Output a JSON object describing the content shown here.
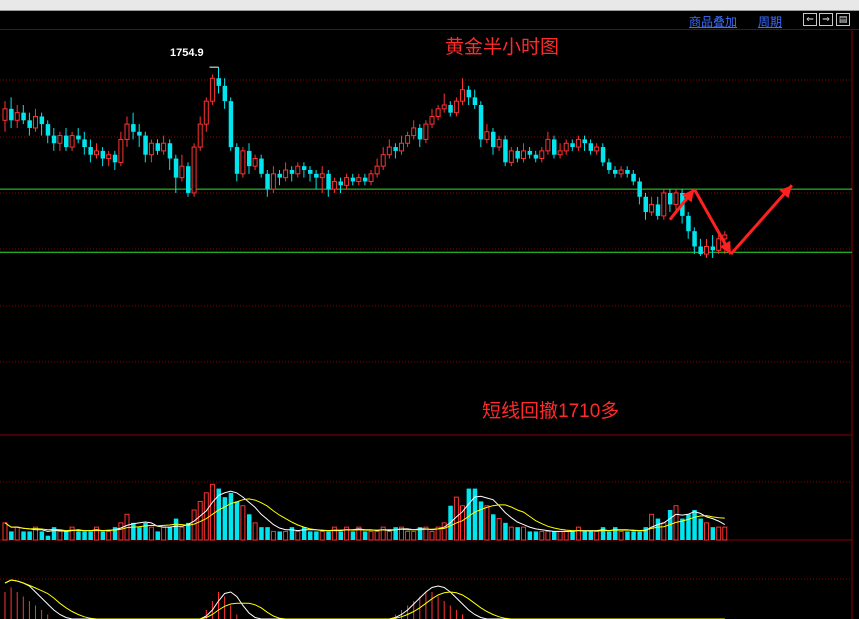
{
  "toolbar": {
    "overlay_label": "商品叠加",
    "period_label": "周期",
    "buttons": [
      {
        "name": "scroll-left-icon",
        "glyph": "⇐"
      },
      {
        "name": "scroll-right-icon",
        "glyph": "⇒"
      },
      {
        "name": "panel-toggle-icon",
        "glyph": "▤"
      }
    ]
  },
  "chart": {
    "title": "黄金半小时图",
    "annotation": "短线回撤1710多",
    "high_label": "1754.9",
    "colors": {
      "background": "#000000",
      "up": "#ff3232",
      "down": "#00e5ee",
      "grid": "#8b0000",
      "support": "#2ee02e",
      "arrow": "#ff2020",
      "ma_white": "#ffffff",
      "ma_yellow": "#ffff00"
    }
  },
  "chart_data": [
    {
      "type": "candlestick",
      "title": "黄金半小时图",
      "note": "price scale labels not visible; values in approximate price units",
      "ylim": [
        1694,
        1762
      ],
      "horizontal_lines": [
        1723,
        1706.5
      ],
      "high_marker": {
        "label": "1754.9",
        "index": 35,
        "value": 1754.9
      },
      "annotation": "短线回撤1710多",
      "candles": [
        {
          "o": 1741,
          "c": 1744,
          "h": 1746,
          "l": 1738
        },
        {
          "o": 1744,
          "c": 1741,
          "h": 1747,
          "l": 1739
        },
        {
          "o": 1741,
          "c": 1743,
          "h": 1745,
          "l": 1739
        },
        {
          "o": 1743,
          "c": 1741,
          "h": 1745,
          "l": 1740
        },
        {
          "o": 1741,
          "c": 1739,
          "h": 1743,
          "l": 1737
        },
        {
          "o": 1739,
          "c": 1742,
          "h": 1744,
          "l": 1738
        },
        {
          "o": 1742,
          "c": 1740,
          "h": 1743,
          "l": 1737
        },
        {
          "o": 1740,
          "c": 1737,
          "h": 1741,
          "l": 1735
        },
        {
          "o": 1737,
          "c": 1735,
          "h": 1739,
          "l": 1733
        },
        {
          "o": 1735,
          "c": 1737,
          "h": 1738,
          "l": 1733
        },
        {
          "o": 1737,
          "c": 1734,
          "h": 1739,
          "l": 1733
        },
        {
          "o": 1734,
          "c": 1737,
          "h": 1738,
          "l": 1733
        },
        {
          "o": 1737,
          "c": 1736,
          "h": 1739,
          "l": 1735
        },
        {
          "o": 1736,
          "c": 1734,
          "h": 1738,
          "l": 1732
        },
        {
          "o": 1734,
          "c": 1732,
          "h": 1736,
          "l": 1730
        },
        {
          "o": 1732,
          "c": 1733,
          "h": 1735,
          "l": 1731
        },
        {
          "o": 1733,
          "c": 1731,
          "h": 1734,
          "l": 1729
        },
        {
          "o": 1731,
          "c": 1732,
          "h": 1733,
          "l": 1729
        },
        {
          "o": 1732,
          "c": 1730,
          "h": 1733,
          "l": 1728
        },
        {
          "o": 1730,
          "c": 1736,
          "h": 1738,
          "l": 1729
        },
        {
          "o": 1736,
          "c": 1740,
          "h": 1742,
          "l": 1734
        },
        {
          "o": 1740,
          "c": 1738,
          "h": 1743,
          "l": 1736
        },
        {
          "o": 1738,
          "c": 1737,
          "h": 1740,
          "l": 1734
        },
        {
          "o": 1737,
          "c": 1732,
          "h": 1738,
          "l": 1730
        },
        {
          "o": 1732,
          "c": 1735,
          "h": 1736,
          "l": 1730
        },
        {
          "o": 1735,
          "c": 1733,
          "h": 1736,
          "l": 1732
        },
        {
          "o": 1733,
          "c": 1735,
          "h": 1737,
          "l": 1732
        },
        {
          "o": 1735,
          "c": 1731,
          "h": 1736,
          "l": 1728
        },
        {
          "o": 1731,
          "c": 1726,
          "h": 1732,
          "l": 1722
        },
        {
          "o": 1726,
          "c": 1729,
          "h": 1732,
          "l": 1725
        },
        {
          "o": 1729,
          "c": 1722,
          "h": 1730,
          "l": 1721
        },
        {
          "o": 1722,
          "c": 1734,
          "h": 1735,
          "l": 1721
        },
        {
          "o": 1734,
          "c": 1740,
          "h": 1742,
          "l": 1733
        },
        {
          "o": 1740,
          "c": 1746,
          "h": 1747,
          "l": 1738
        },
        {
          "o": 1746,
          "c": 1752,
          "h": 1753,
          "l": 1745
        },
        {
          "o": 1752,
          "c": 1750,
          "h": 1754.9,
          "l": 1748
        },
        {
          "o": 1750,
          "c": 1746,
          "h": 1752,
          "l": 1744
        },
        {
          "o": 1746,
          "c": 1734,
          "h": 1747,
          "l": 1733
        },
        {
          "o": 1734,
          "c": 1727,
          "h": 1735,
          "l": 1725
        },
        {
          "o": 1727,
          "c": 1733,
          "h": 1734,
          "l": 1726
        },
        {
          "o": 1733,
          "c": 1729,
          "h": 1735,
          "l": 1727
        },
        {
          "o": 1729,
          "c": 1731,
          "h": 1732,
          "l": 1728
        },
        {
          "o": 1731,
          "c": 1727,
          "h": 1732,
          "l": 1726
        },
        {
          "o": 1727,
          "c": 1723,
          "h": 1728,
          "l": 1721
        },
        {
          "o": 1723,
          "c": 1727,
          "h": 1729,
          "l": 1722
        },
        {
          "o": 1727,
          "c": 1726,
          "h": 1728,
          "l": 1724
        },
        {
          "o": 1726,
          "c": 1728,
          "h": 1730,
          "l": 1725
        },
        {
          "o": 1728,
          "c": 1727,
          "h": 1729,
          "l": 1725
        },
        {
          "o": 1727,
          "c": 1729,
          "h": 1730,
          "l": 1726
        },
        {
          "o": 1729,
          "c": 1728,
          "h": 1730,
          "l": 1726
        },
        {
          "o": 1728,
          "c": 1727,
          "h": 1729,
          "l": 1725
        },
        {
          "o": 1727,
          "c": 1726,
          "h": 1728,
          "l": 1723
        },
        {
          "o": 1726,
          "c": 1727,
          "h": 1729,
          "l": 1722
        },
        {
          "o": 1727,
          "c": 1723,
          "h": 1728,
          "l": 1721
        },
        {
          "o": 1723,
          "c": 1725,
          "h": 1726,
          "l": 1722
        },
        {
          "o": 1725,
          "c": 1724,
          "h": 1726,
          "l": 1722
        },
        {
          "o": 1724,
          "c": 1726,
          "h": 1727,
          "l": 1723
        },
        {
          "o": 1726,
          "c": 1725,
          "h": 1727,
          "l": 1724
        },
        {
          "o": 1725,
          "c": 1726,
          "h": 1727,
          "l": 1724
        },
        {
          "o": 1726,
          "c": 1725,
          "h": 1727,
          "l": 1724
        },
        {
          "o": 1725,
          "c": 1727,
          "h": 1728,
          "l": 1724
        },
        {
          "o": 1727,
          "c": 1729,
          "h": 1731,
          "l": 1726
        },
        {
          "o": 1729,
          "c": 1732,
          "h": 1734,
          "l": 1728
        },
        {
          "o": 1732,
          "c": 1734,
          "h": 1736,
          "l": 1731
        },
        {
          "o": 1734,
          "c": 1733,
          "h": 1735,
          "l": 1731
        },
        {
          "o": 1733,
          "c": 1735,
          "h": 1737,
          "l": 1732
        },
        {
          "o": 1735,
          "c": 1737,
          "h": 1738,
          "l": 1734
        },
        {
          "o": 1737,
          "c": 1739,
          "h": 1741,
          "l": 1736
        },
        {
          "o": 1739,
          "c": 1736,
          "h": 1740,
          "l": 1734
        },
        {
          "o": 1736,
          "c": 1740,
          "h": 1741,
          "l": 1735
        },
        {
          "o": 1740,
          "c": 1742,
          "h": 1744,
          "l": 1739
        },
        {
          "o": 1742,
          "c": 1744,
          "h": 1745,
          "l": 1741
        },
        {
          "o": 1744,
          "c": 1745,
          "h": 1748,
          "l": 1743
        },
        {
          "o": 1745,
          "c": 1743,
          "h": 1746,
          "l": 1742
        },
        {
          "o": 1743,
          "c": 1746,
          "h": 1747,
          "l": 1742
        },
        {
          "o": 1746,
          "c": 1749,
          "h": 1752,
          "l": 1745
        },
        {
          "o": 1749,
          "c": 1747,
          "h": 1750,
          "l": 1745
        },
        {
          "o": 1747,
          "c": 1745,
          "h": 1749,
          "l": 1744
        },
        {
          "o": 1745,
          "c": 1736,
          "h": 1746,
          "l": 1734
        },
        {
          "o": 1736,
          "c": 1738,
          "h": 1740,
          "l": 1735
        },
        {
          "o": 1738,
          "c": 1734,
          "h": 1739,
          "l": 1732
        },
        {
          "o": 1734,
          "c": 1736,
          "h": 1737,
          "l": 1733
        },
        {
          "o": 1736,
          "c": 1730,
          "h": 1737,
          "l": 1729
        },
        {
          "o": 1730,
          "c": 1733,
          "h": 1734,
          "l": 1729
        },
        {
          "o": 1733,
          "c": 1731,
          "h": 1734,
          "l": 1730
        },
        {
          "o": 1731,
          "c": 1733,
          "h": 1735,
          "l": 1730
        },
        {
          "o": 1733,
          "c": 1732,
          "h": 1734,
          "l": 1731
        },
        {
          "o": 1732,
          "c": 1731,
          "h": 1733,
          "l": 1730
        },
        {
          "o": 1731,
          "c": 1733,
          "h": 1734,
          "l": 1730
        },
        {
          "o": 1733,
          "c": 1736,
          "h": 1738,
          "l": 1732
        },
        {
          "o": 1736,
          "c": 1732,
          "h": 1737,
          "l": 1731
        },
        {
          "o": 1732,
          "c": 1733,
          "h": 1735,
          "l": 1731
        },
        {
          "o": 1733,
          "c": 1735,
          "h": 1736,
          "l": 1732
        },
        {
          "o": 1735,
          "c": 1734,
          "h": 1736,
          "l": 1733
        },
        {
          "o": 1734,
          "c": 1736,
          "h": 1737,
          "l": 1733
        },
        {
          "o": 1736,
          "c": 1735,
          "h": 1737,
          "l": 1733
        },
        {
          "o": 1735,
          "c": 1733,
          "h": 1736,
          "l": 1732
        },
        {
          "o": 1733,
          "c": 1734,
          "h": 1735,
          "l": 1732
        },
        {
          "o": 1734,
          "c": 1730,
          "h": 1735,
          "l": 1729
        },
        {
          "o": 1730,
          "c": 1728,
          "h": 1731,
          "l": 1727
        },
        {
          "o": 1728,
          "c": 1727,
          "h": 1729,
          "l": 1726
        },
        {
          "o": 1727,
          "c": 1728,
          "h": 1729,
          "l": 1726
        },
        {
          "o": 1728,
          "c": 1727,
          "h": 1729,
          "l": 1726
        },
        {
          "o": 1727,
          "c": 1725,
          "h": 1728,
          "l": 1724
        },
        {
          "o": 1725,
          "c": 1721,
          "h": 1726,
          "l": 1719
        },
        {
          "o": 1721,
          "c": 1717,
          "h": 1722,
          "l": 1715
        },
        {
          "o": 1717,
          "c": 1719,
          "h": 1721,
          "l": 1716
        },
        {
          "o": 1719,
          "c": 1716,
          "h": 1721,
          "l": 1715
        },
        {
          "o": 1716,
          "c": 1722,
          "h": 1723,
          "l": 1715
        },
        {
          "o": 1722,
          "c": 1719,
          "h": 1723,
          "l": 1717
        },
        {
          "o": 1719,
          "c": 1722,
          "h": 1723,
          "l": 1717
        },
        {
          "o": 1722,
          "c": 1716,
          "h": 1723,
          "l": 1714
        },
        {
          "o": 1716,
          "c": 1712,
          "h": 1717,
          "l": 1710
        },
        {
          "o": 1712,
          "c": 1708,
          "h": 1713,
          "l": 1706
        },
        {
          "o": 1708,
          "c": 1706,
          "h": 1710,
          "l": 1705.5
        },
        {
          "o": 1706,
          "c": 1708,
          "h": 1710,
          "l": 1705
        },
        {
          "o": 1708,
          "c": 1707,
          "h": 1711,
          "l": 1705
        },
        {
          "o": 1707,
          "c": 1710,
          "h": 1712,
          "l": 1706
        },
        {
          "o": 1710,
          "c": 1711,
          "h": 1712,
          "l": 1706
        }
      ],
      "arrows": [
        {
          "from": [
            109,
            1715
          ],
          "to": [
            113,
            1723
          ]
        },
        {
          "from": [
            113,
            1723
          ],
          "to": [
            119,
            1706
          ]
        },
        {
          "from": [
            119,
            1706
          ],
          "to": [
            129,
            1724
          ]
        }
      ]
    },
    {
      "type": "bar",
      "title": "",
      "series": [
        {
          "name": "",
          "values": [
            4,
            2,
            3,
            2,
            2,
            3,
            2,
            1,
            3,
            2,
            2,
            3,
            2,
            2,
            2,
            3,
            2,
            2,
            3,
            4,
            6,
            4,
            3,
            4,
            3,
            2,
            3,
            3,
            5,
            3,
            4,
            7,
            9,
            11,
            13,
            12,
            10,
            11,
            9,
            8,
            6,
            4,
            3,
            3,
            2,
            2,
            2,
            3,
            2,
            3,
            2,
            2,
            2,
            2,
            3,
            2,
            3,
            2,
            3,
            2,
            2,
            2,
            3,
            2,
            3,
            3,
            2,
            2,
            3,
            3,
            2,
            3,
            4,
            8,
            10,
            8,
            12,
            12,
            9,
            8,
            6,
            5,
            4,
            3,
            3,
            3,
            2,
            2,
            2,
            2,
            2,
            2,
            2,
            2,
            3,
            2,
            2,
            2,
            3,
            2,
            3,
            2,
            2,
            2,
            2,
            3,
            6,
            5,
            4,
            7,
            8,
            5,
            6,
            7,
            5,
            4,
            3,
            3,
            3
          ]
        }
      ],
      "ylim": [
        0,
        14
      ],
      "moving_averages": [
        "white",
        "yellow"
      ]
    },
    {
      "type": "bar",
      "title": "",
      "note": "MACD-style histogram, partially visible at bottom edge",
      "series": [
        {
          "name": "",
          "values": [
            6,
            7,
            6,
            5,
            4,
            3,
            2,
            1,
            0,
            0,
            0,
            0,
            0,
            0,
            0,
            0,
            0,
            0,
            0,
            0,
            0,
            0,
            0,
            0,
            0,
            0,
            0,
            0,
            0,
            0,
            0,
            0,
            0,
            2,
            4,
            6,
            5,
            3,
            1,
            0,
            0,
            0,
            0,
            0,
            0,
            0,
            0,
            0,
            0,
            0,
            0,
            0,
            0,
            0,
            0,
            0,
            0,
            0,
            0,
            0,
            0,
            0,
            0,
            0,
            1,
            2,
            3,
            4,
            5,
            6,
            6,
            5,
            4,
            3,
            2,
            1,
            0,
            0,
            0,
            0,
            0,
            0,
            0,
            0,
            0,
            0,
            0,
            0,
            0,
            0,
            0,
            0,
            0,
            0,
            0,
            0,
            0,
            0,
            0,
            0,
            0,
            0,
            0,
            0,
            0,
            0,
            0,
            0,
            0,
            0,
            0,
            0,
            0,
            0,
            0,
            0,
            0,
            0,
            0
          ]
        }
      ],
      "ylim": [
        0,
        10
      ]
    }
  ]
}
